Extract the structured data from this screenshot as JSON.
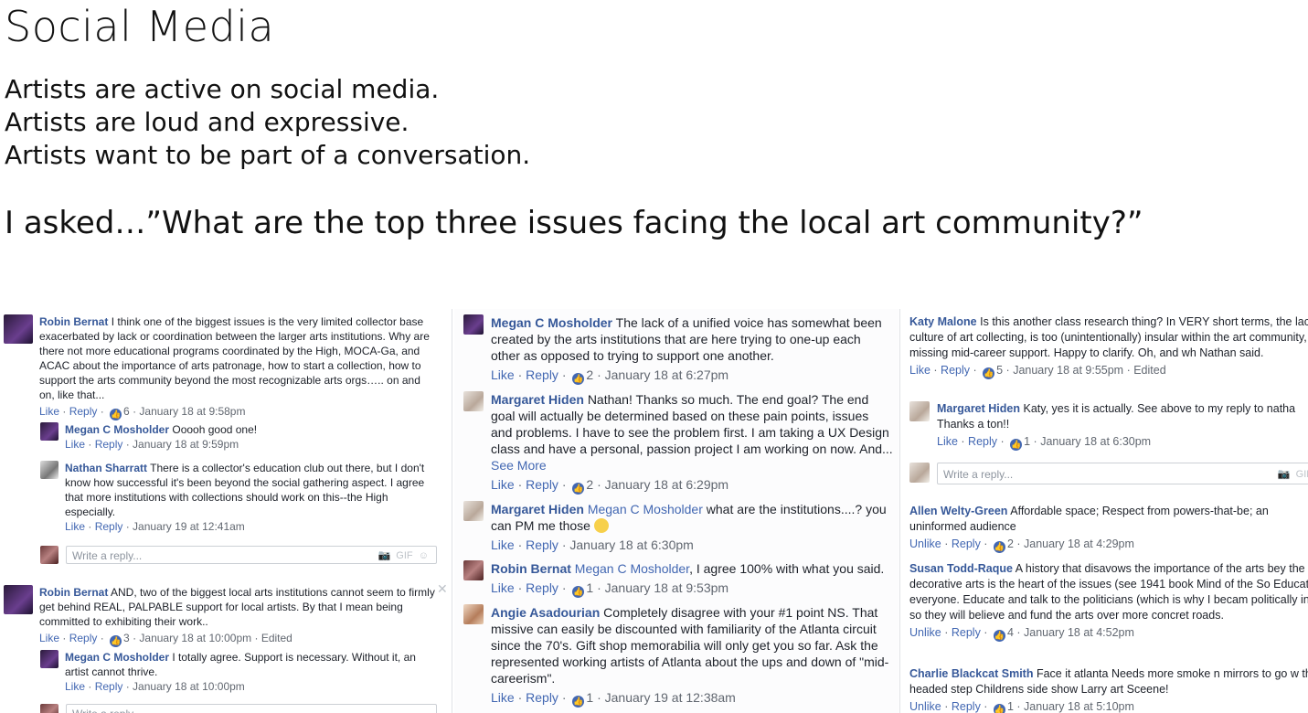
{
  "slide": {
    "title": "Social Media",
    "bullets": [
      "Artists are active on social media.",
      "Artists are loud and expressive.",
      "Artists want to be part of a conversation."
    ],
    "question": "I asked…”What are the top three issues facing the local art community?”"
  },
  "ui": {
    "like": "Like",
    "unlike": "Unlike",
    "reply": "Reply",
    "edited": "Edited",
    "see_more": "See More",
    "write_reply": "Write a reply...",
    "gif": "GIF"
  },
  "col1": [
    {
      "author": "Robin Bernat",
      "text": "I think one of the biggest issues is the very limited collector base exacerbated by lack or coordination between the larger arts institutions. Why are there not more educational programs coordinated by the High, MOCA-Ga, and ACAC about the importance of arts patronage, how to start a collection, how to support the arts community beyond the most recognizable arts orgs….. on and on, like that...",
      "likes": "6",
      "time": "January 18 at 9:58pm"
    },
    {
      "author": "Megan C Mosholder",
      "text": "Ooooh good one!",
      "time": "January 18 at 9:59pm"
    },
    {
      "author": "Nathan Sharratt",
      "text": "There is a collector's education club out there, but I don't know how successful it's been beyond the social gathering aspect. I agree that more institutions with collections should work on this--the High especially.",
      "time": "January 19 at 12:41am"
    },
    {
      "author": "Robin Bernat",
      "text": "AND, two of the biggest local arts institutions cannot seem to firmly get behind REAL, PALPABLE support for local artists. By that I mean being committed to exhibiting their work..",
      "likes": "3",
      "time": "January 18 at 10:00pm"
    },
    {
      "author": "Megan C Mosholder",
      "text": "I totally agree. Support is necessary. Without it, an artist cannot thrive.",
      "time": "January 18 at 10:00pm"
    }
  ],
  "col2": [
    {
      "author": "Megan C Mosholder",
      "text": "The lack of a unified voice has somewhat been created by the arts institutions that are here trying to one-up each other as opposed to trying to support one another.",
      "likes": "2",
      "time": "January 18 at 6:27pm"
    },
    {
      "author": "Margaret Hiden",
      "text": "Nathan! Thanks so much. The end goal? The end goal will actually be determined based on these pain points, issues and problems. I have to see the problem first. I am taking a UX Design class and have a personal, passion project I am working on now. And...",
      "likes": "2",
      "time": "January 18 at 6:29pm"
    },
    {
      "author": "Margaret Hiden",
      "tag": "Megan C Mosholder",
      "text": "what are the institutions....? you can PM me those",
      "time": "January 18 at 6:30pm"
    },
    {
      "author": "Robin Bernat",
      "tag": "Megan C Mosholder",
      "text": ", I agree 100% with what you said.",
      "likes": "1",
      "time": "January 18 at 9:53pm"
    },
    {
      "author": "Angie Asadourian",
      "text": "Completely disagree with your #1 point NS. That missive can easily be discounted with familiarity of the Atlanta circuit since the 70's. Gift shop memorabilia will only get you so far. Ask the represented working artists of Atlanta about the ups and down of \"mid-careerism\".",
      "likes": "1",
      "time": "January 19 at 12:38am"
    }
  ],
  "col3": [
    {
      "author": "Katy Malone",
      "text": "Is this another class research thing? In VERY short terms, the lacks a culture of art collecting, is too (unintentionally) insular within the art community, and is missing mid-career support. Happy to clarify. Oh, and wh Nathan said.",
      "likes": "5",
      "time": "January 18 at 9:55pm"
    },
    {
      "author": "Margaret Hiden",
      "text": "Katy, yes it is actually. See above to my reply to natha Thanks a ton!!",
      "likes": "1",
      "time": "January 18 at 6:30pm"
    },
    {
      "author": "Allen Welty-Green",
      "text": "Affordable space; Respect from powers-that-be; an uninformed audience",
      "likes": "2",
      "time": "January 18 at 4:29pm"
    },
    {
      "author": "Susan Todd-Raque",
      "text": "A history that disavows the importance of the arts bey the decorative arts is the heart of the issues (see 1941 book Mind of the So Educate everyone. Educate and talk to the politicians (which is why I becam politically involved) so they will believe and fund the arts over more concret roads.",
      "likes": "4",
      "time": "January 18 at 4:52pm"
    },
    {
      "author": "Charlie Blackcat Smith",
      "text": "Face it atlanta Needs more smoke n mirrors to go w the red headed step Childrens side show Larry art Sceene!",
      "likes": "1",
      "time": "January 18 at 5:10pm"
    }
  ]
}
